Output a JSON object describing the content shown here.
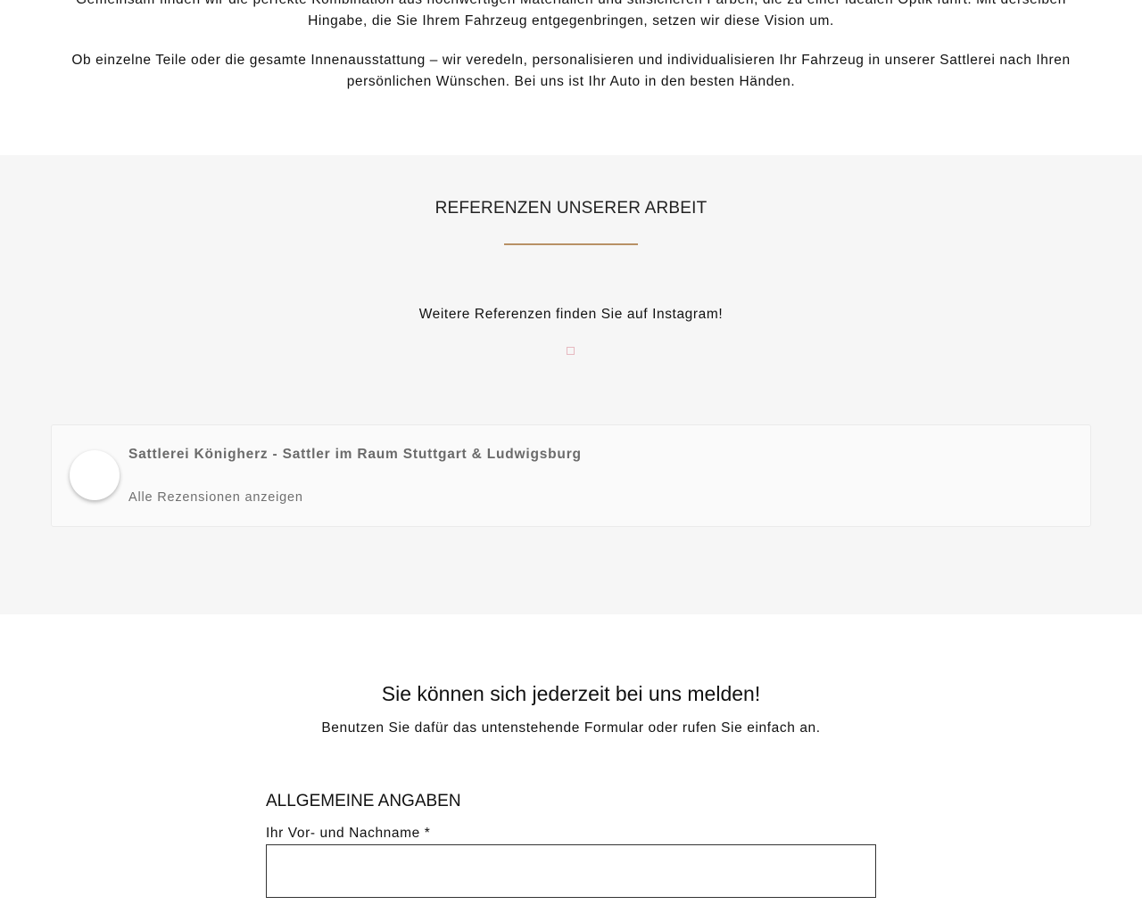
{
  "intro": {
    "paragraph1": "Gemeinsam finden wir die perfekte Kombination aus hochwertigen Materialien und stilsicheren Farben, die zu einer idealen Optik führt. Mit derselben Hingabe, die Sie Ihrem Fahrzeug entgegenbringen, setzen wir diese Vision um.",
    "paragraph2": "Ob einzelne Teile oder die gesamte Innenausstattung – wir veredeln, personalisieren und individualisieren Ihr Fahrzeug in unserer Sattlerei nach Ihren persönlichen Wünschen. Bei uns ist Ihr Auto in den besten Händen."
  },
  "references": {
    "title": "REFERENZEN UNSERER ARBEIT",
    "instagram_text": "Weitere Referenzen finden Sie auf Instagram!",
    "instagram_icon": "instagram-icon",
    "accent_color": "#b89165"
  },
  "review_widget": {
    "business_name": "Sattlerei Königherz - Sattler im Raum Stuttgart & Ludwigsburg",
    "all_reviews_label": "Alle Rezensionen anzeigen"
  },
  "contact": {
    "heading": "Sie können sich jederzeit bei uns melden!",
    "subheading": "Benutzen Sie dafür das untenstehende Formular oder rufen Sie einfach an.",
    "section_title": "ALLGEMEINE ANGABEN",
    "name_label": "Ihr Vor- und Nachname *",
    "name_value": ""
  }
}
